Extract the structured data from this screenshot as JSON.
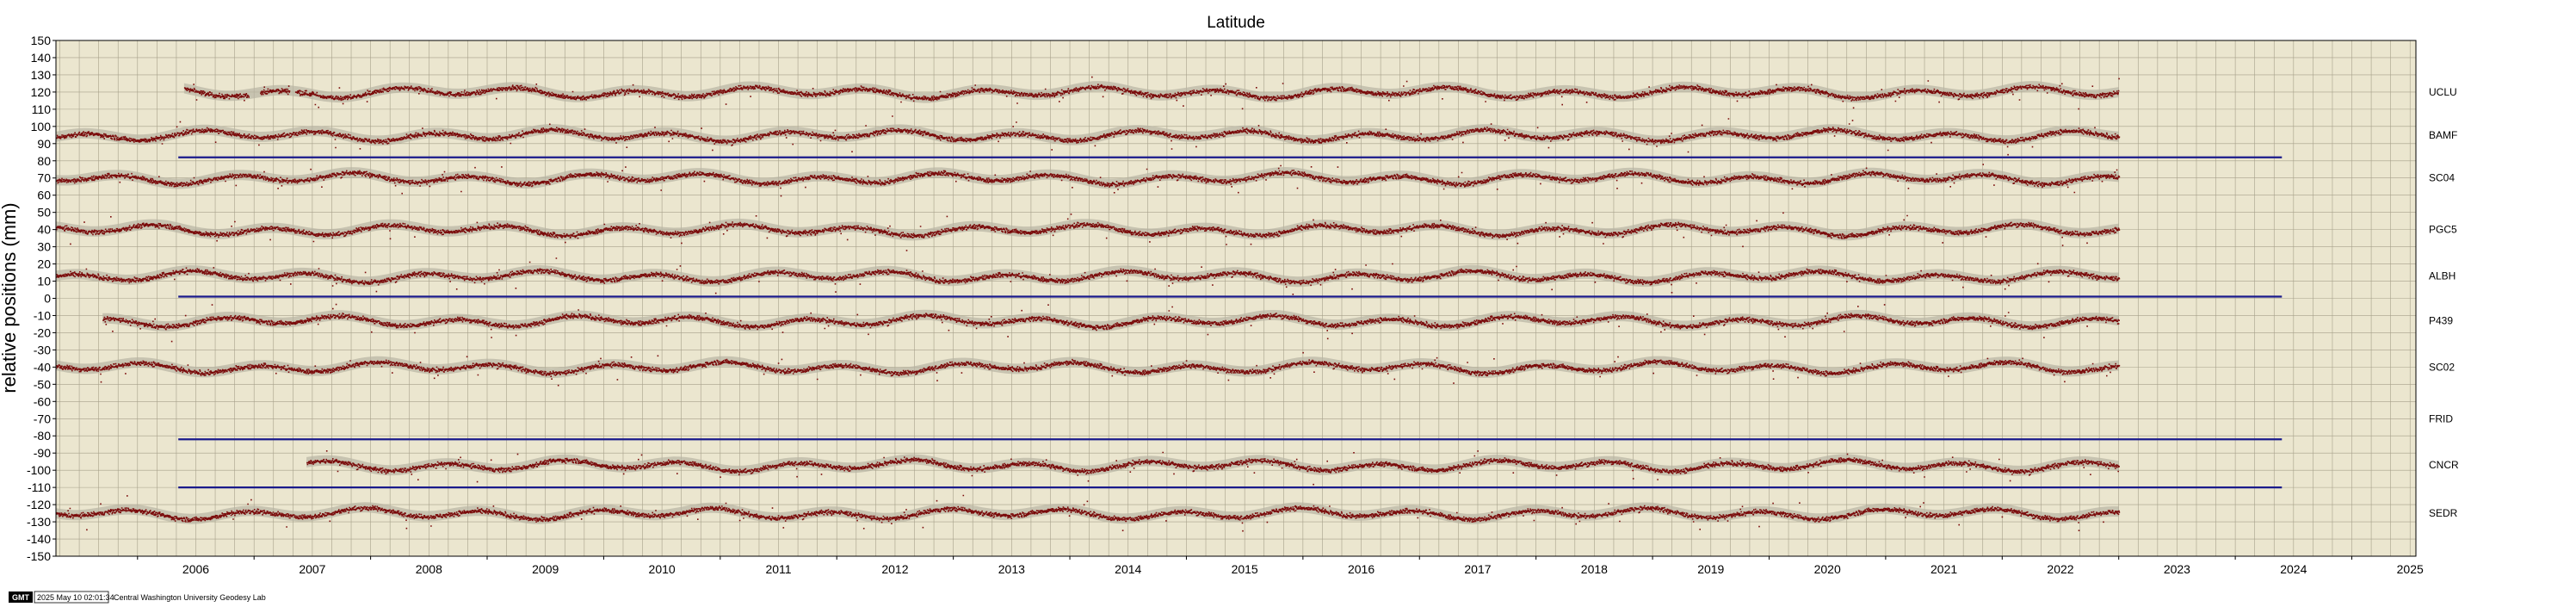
{
  "chart_data": {
    "type": "scatter",
    "title": "Latitude",
    "ylabel": "relative positions (mm)",
    "xlabel": "",
    "xlim": [
      2005.3,
      2025.55
    ],
    "ylim": [
      -150,
      150
    ],
    "y_ticks": [
      150,
      140,
      130,
      120,
      110,
      100,
      90,
      80,
      70,
      60,
      50,
      40,
      30,
      20,
      10,
      0,
      -10,
      -20,
      -30,
      -40,
      -50,
      -60,
      -70,
      -80,
      -90,
      -100,
      -110,
      -120,
      -130,
      -140,
      -150
    ],
    "x_ticks": [
      2006,
      2007,
      2008,
      2009,
      2010,
      2011,
      2012,
      2013,
      2014,
      2015,
      2016,
      2017,
      2018,
      2019,
      2020,
      2021,
      2022,
      2023,
      2024,
      2025
    ],
    "grid": true,
    "legend": "none",
    "colors": {
      "background": "#ebe6cf",
      "points": "#7a0a0a",
      "model_band": "#b8b3a3",
      "reference_line": "#1a1a8c",
      "grid": "#a6a08a"
    },
    "series": [
      {
        "name": "UCLU",
        "offset": 120,
        "start": 2006.4,
        "end": 2023.0,
        "gaps": [
          [
            2006.95,
            2007.05
          ],
          [
            2007.3,
            2007.35
          ]
        ]
      },
      {
        "name": "BAMF",
        "offset": 95,
        "start": 2005.3,
        "end": 2023.0,
        "gaps": []
      },
      {
        "name": "SC04",
        "offset": 70,
        "start": 2005.3,
        "end": 2023.0,
        "gaps": []
      },
      {
        "name": "PGC5",
        "offset": 40,
        "start": 2005.3,
        "end": 2023.0,
        "gaps": []
      },
      {
        "name": "ALBH",
        "offset": 13,
        "start": 2005.3,
        "end": 2023.0,
        "gaps": []
      },
      {
        "name": "P439",
        "offset": -13,
        "start": 2005.7,
        "end": 2023.0,
        "gaps": []
      },
      {
        "name": "SC02",
        "offset": -40,
        "start": 2005.3,
        "end": 2023.0,
        "gaps": []
      },
      {
        "name": "FRID",
        "offset": -70,
        "start": null,
        "end": null,
        "gaps": []
      },
      {
        "name": "CNCR",
        "offset": -97,
        "start": 2007.45,
        "end": 2023.0,
        "gaps": []
      },
      {
        "name": "SEDR",
        "offset": -125,
        "start": 2005.3,
        "end": 2023.0,
        "gaps": []
      }
    ],
    "reference_lines": [
      {
        "y": 82,
        "x_start": 2006.35,
        "x_end": 2024.4
      },
      {
        "y": 1,
        "x_start": 2006.35,
        "x_end": 2024.4
      },
      {
        "y": -82,
        "x_start": 2006.35,
        "x_end": 2024.4
      },
      {
        "y": -110,
        "x_start": 2006.35,
        "x_end": 2024.4
      }
    ]
  },
  "footer": {
    "logo_text": "GMT",
    "timestamp": "2025 May 10 02:01:34",
    "credit": "Central Washington University Geodesy Lab"
  }
}
